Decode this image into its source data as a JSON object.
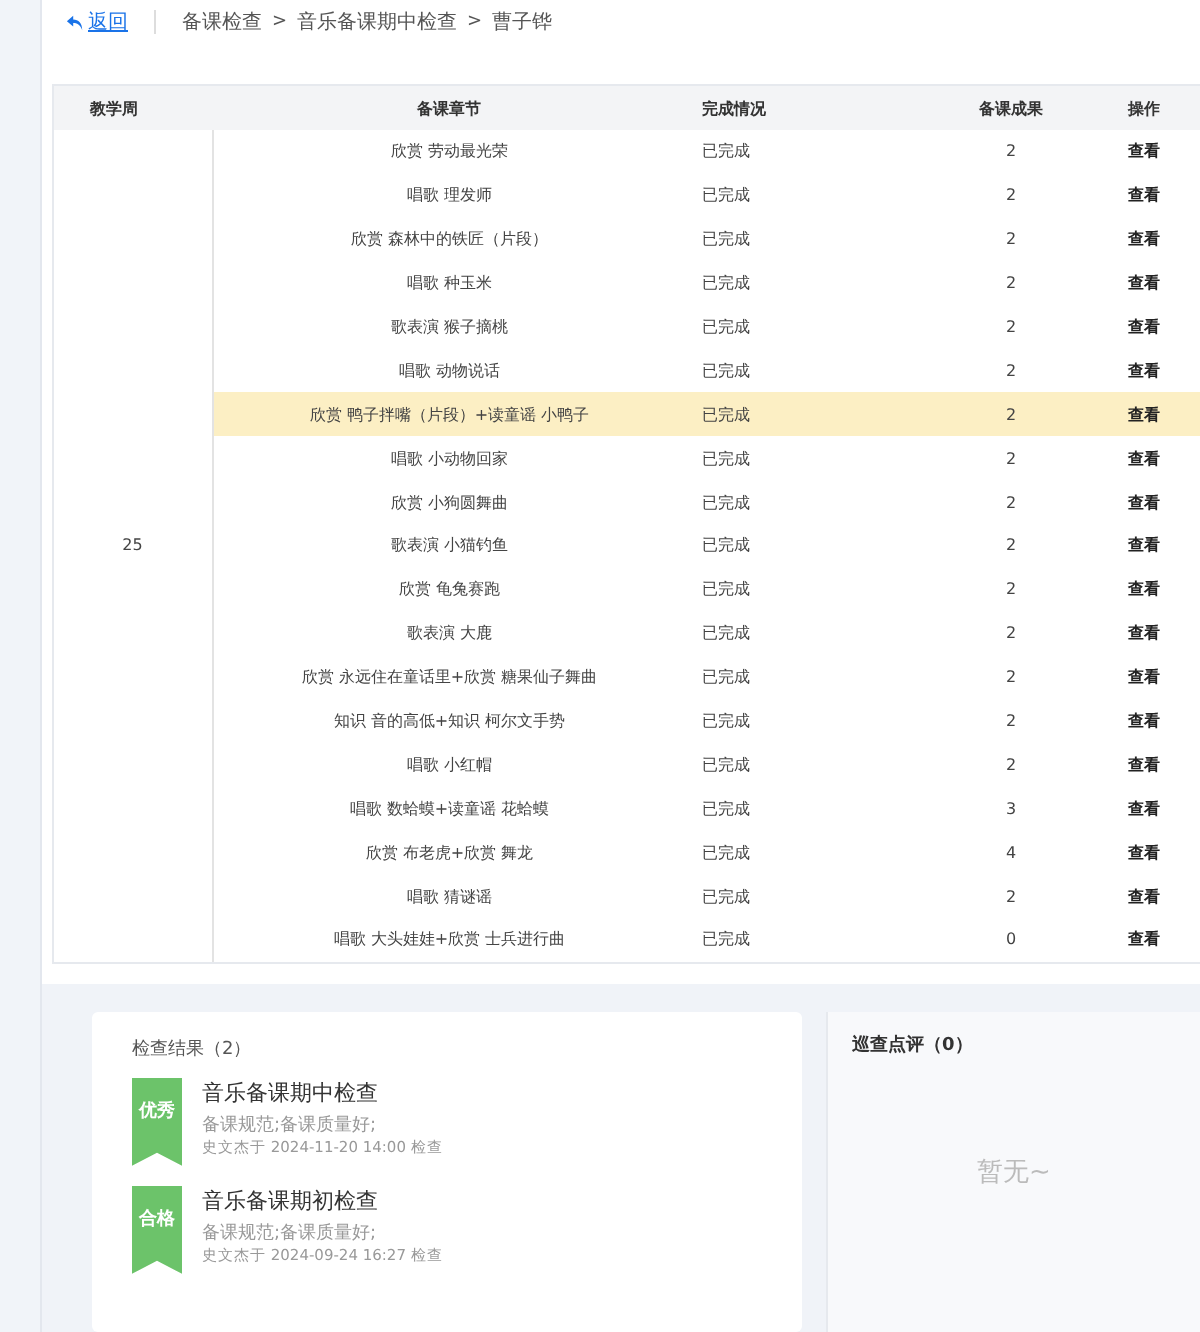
{
  "breadcrumb": {
    "back": "返回",
    "items": [
      "备课检查",
      "音乐备课期中检查",
      "曹子铧"
    ],
    "separator": ">"
  },
  "table": {
    "columns": [
      "教学周",
      "备课章节",
      "完成情况",
      "备课成果",
      "操作"
    ],
    "week": "25",
    "rows": [
      {
        "chapter": "欣赏 劳动最光荣",
        "status": "已完成",
        "result": "2",
        "action": "查看",
        "highlighted": false
      },
      {
        "chapter": "唱歌 理发师",
        "status": "已完成",
        "result": "2",
        "action": "查看",
        "highlighted": false
      },
      {
        "chapter": "欣赏 森林中的铁匠（片段）",
        "status": "已完成",
        "result": "2",
        "action": "查看",
        "highlighted": false
      },
      {
        "chapter": "唱歌 种玉米",
        "status": "已完成",
        "result": "2",
        "action": "查看",
        "highlighted": false
      },
      {
        "chapter": "歌表演 猴子摘桃",
        "status": "已完成",
        "result": "2",
        "action": "查看",
        "highlighted": false
      },
      {
        "chapter": "唱歌 动物说话",
        "status": "已完成",
        "result": "2",
        "action": "查看",
        "highlighted": false
      },
      {
        "chapter": "欣赏 鸭子拌嘴（片段）+读童谣 小鸭子",
        "status": "已完成",
        "result": "2",
        "action": "查看",
        "highlighted": true
      },
      {
        "chapter": "唱歌 小动物回家",
        "status": "已完成",
        "result": "2",
        "action": "查看",
        "highlighted": false
      },
      {
        "chapter": "欣赏 小狗圆舞曲",
        "status": "已完成",
        "result": "2",
        "action": "查看",
        "highlighted": false
      },
      {
        "chapter": "歌表演 小猫钓鱼",
        "status": "已完成",
        "result": "2",
        "action": "查看",
        "highlighted": false
      },
      {
        "chapter": "欣赏 龟兔赛跑",
        "status": "已完成",
        "result": "2",
        "action": "查看",
        "highlighted": false
      },
      {
        "chapter": "歌表演 大鹿",
        "status": "已完成",
        "result": "2",
        "action": "查看",
        "highlighted": false
      },
      {
        "chapter": "欣赏 永远住在童话里+欣赏 糖果仙子舞曲",
        "status": "已完成",
        "result": "2",
        "action": "查看",
        "highlighted": false
      },
      {
        "chapter": "知识 音的高低+知识 柯尔文手势",
        "status": "已完成",
        "result": "2",
        "action": "查看",
        "highlighted": false
      },
      {
        "chapter": "唱歌 小红帽",
        "status": "已完成",
        "result": "2",
        "action": "查看",
        "highlighted": false
      },
      {
        "chapter": "唱歌 数蛤蟆+读童谣 花蛤蟆",
        "status": "已完成",
        "result": "3",
        "action": "查看",
        "highlighted": false
      },
      {
        "chapter": "欣赏 布老虎+欣赏 舞龙",
        "status": "已完成",
        "result": "4",
        "action": "查看",
        "highlighted": false
      },
      {
        "chapter": "唱歌 猜谜谣",
        "status": "已完成",
        "result": "2",
        "action": "查看",
        "highlighted": false
      },
      {
        "chapter": "唱歌 大头娃娃+欣赏 士兵进行曲",
        "status": "已完成",
        "result": "0",
        "action": "查看",
        "highlighted": false
      }
    ]
  },
  "check_results": {
    "title": "检查结果（2）",
    "items": [
      {
        "grade": "优秀",
        "title": "音乐备课期中检查",
        "comment": "备课规范;备课质量好;",
        "meta": "史文杰于 2024-11-20 14:00 检查"
      },
      {
        "grade": "合格",
        "title": "音乐备课期初检查",
        "comment": "备课规范;备课质量好;",
        "meta": "史文杰于 2024-09-24 16:27 检查"
      }
    ]
  },
  "patrol_comments": {
    "title": "巡查点评（0）",
    "empty": "暂无~"
  }
}
